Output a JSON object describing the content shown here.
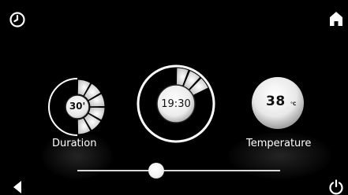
{
  "duration": {
    "value_text": "30'",
    "label": "Duration",
    "level_fraction": 0.5
  },
  "clock": {
    "time": "19:30",
    "progress_fraction": 0.18
  },
  "temperature": {
    "value": "38",
    "unit": "°C",
    "label": "Temperature"
  },
  "slider": {
    "level_fraction": 0.39
  },
  "icons": {
    "top_left": "clock-icon",
    "top_right": "home-icon",
    "bottom_left": "back-arrow-icon",
    "bottom_right": "power-icon"
  },
  "colors": {
    "background": "#000000",
    "foreground": "#ffffff",
    "track": "#d8d8d8"
  }
}
